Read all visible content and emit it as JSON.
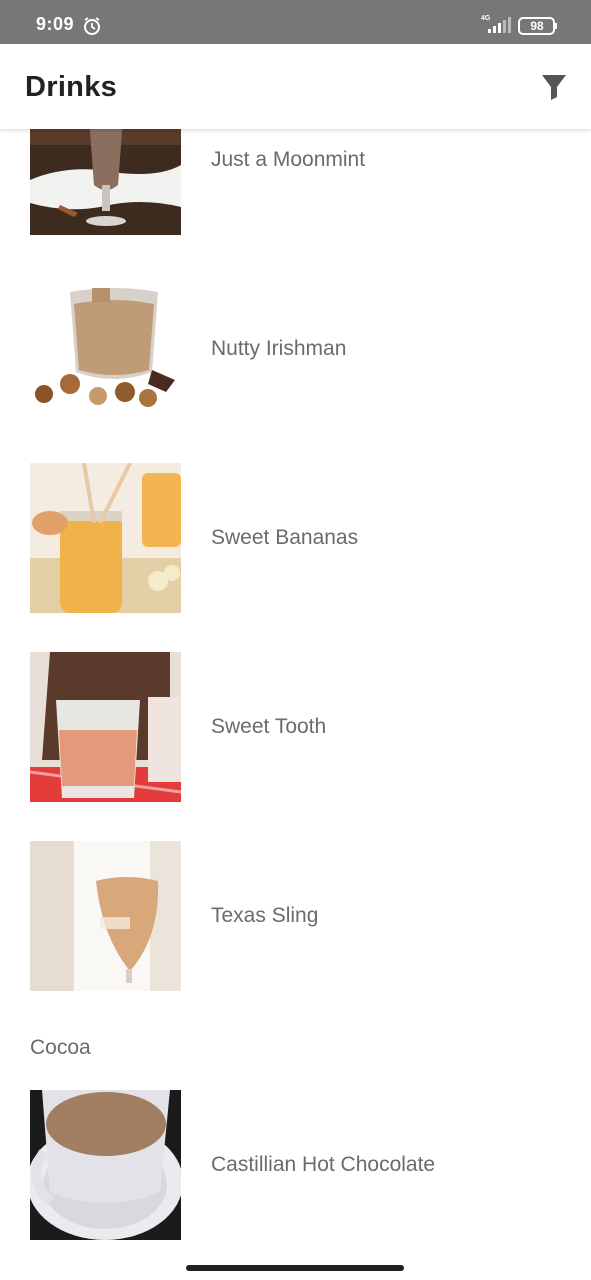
{
  "status_bar": {
    "time": "9:09",
    "network": "4G",
    "battery": "98"
  },
  "app_bar": {
    "title": "Drinks",
    "filter_icon": "filter-icon"
  },
  "drinks": [
    {
      "name": "Just a Moonmint"
    },
    {
      "name": "Nutty Irishman"
    },
    {
      "name": "Sweet Bananas"
    },
    {
      "name": "Sweet Tooth"
    },
    {
      "name": "Texas Sling"
    }
  ],
  "section": {
    "title": "Cocoa",
    "items": [
      {
        "name": "Castillian Hot Chocolate"
      }
    ]
  },
  "colors": {
    "status_bar": "#777777",
    "title_text": "#222222",
    "item_text": "#6b6b6b",
    "filter_icon": "#555555"
  }
}
